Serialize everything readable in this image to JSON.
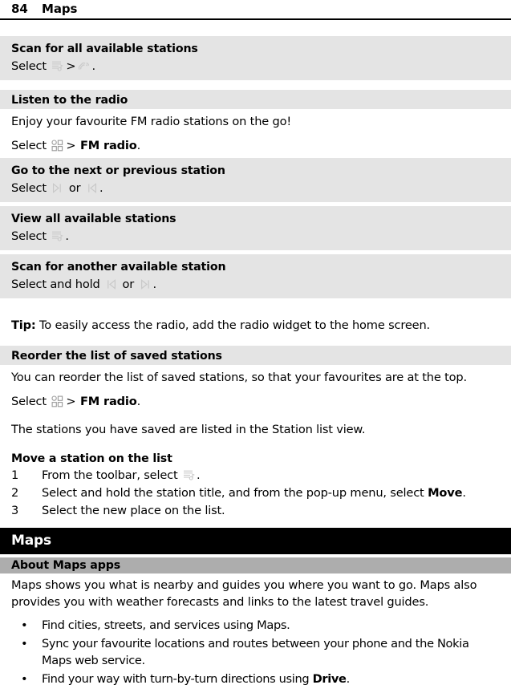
{
  "header": {
    "page_number": "84",
    "chapter": "Maps"
  },
  "sections": {
    "scan_all": {
      "heading": "Scan for all available stations",
      "line_prefix": "Select",
      "icon_1": "station-list-icon",
      "separator": ">",
      "icon_2": "scan-stations-icon",
      "line_suffix": "."
    },
    "listen_radio": {
      "heading": "Listen to the radio",
      "intro": "Enjoy your favourite FM radio stations on the go!",
      "select_prefix": "Select",
      "icon": "app-grid-icon",
      "separator": ">",
      "target": "FM radio",
      "period": "."
    },
    "next_prev": {
      "heading": "Go to the next or previous station",
      "line_prefix": "Select",
      "icon_1": "next-station-icon",
      "conjunction": "or",
      "icon_2": "previous-station-icon",
      "line_suffix": "."
    },
    "view_all": {
      "heading": "View all available stations",
      "line_prefix": "Select",
      "icon_1": "station-list-icon",
      "line_suffix": "."
    },
    "scan_another": {
      "heading": "Scan for another available station",
      "line_prefix": "Select and hold",
      "icon_1": "previous-station-icon",
      "conjunction": "or",
      "icon_2": "next-station-icon",
      "line_suffix": "."
    },
    "tip": {
      "label": "Tip:",
      "text": "To easily access the radio, add the radio widget to the home screen."
    },
    "reorder": {
      "heading": "Reorder the list of saved stations",
      "paragraph_1": "You can reorder the list of saved stations, so that your favourites are at the top.",
      "select_prefix": "Select",
      "icon": "app-grid-icon",
      "separator": ">",
      "target": "FM radio",
      "period": ".",
      "paragraph_2": "The stations you have saved are listed in the Station list view."
    },
    "move_station": {
      "heading": "Move a station on the list",
      "steps": [
        {
          "number": "1",
          "text_before": "From the toolbar, select",
          "icon": "station-list-icon",
          "text_after": ".",
          "bold_term": "",
          "text_tail": ""
        },
        {
          "number": "2",
          "text_before": "Select and hold the station title, and from the pop-up menu, select",
          "icon": "",
          "bold_term": "Move",
          "text_tail": "."
        },
        {
          "number": "3",
          "text_before": "Select the new place on the list.",
          "icon": "",
          "bold_term": "",
          "text_tail": ""
        }
      ]
    }
  },
  "chapter": {
    "title": "Maps",
    "section_title": "About Maps apps",
    "intro": "Maps shows you what is nearby and guides you where you want to go. Maps also provides you with weather forecasts and links to the latest travel guides.",
    "bullets": [
      {
        "text_before": "Find cities, streets, and services using Maps.",
        "bold_term": "",
        "text_after": ""
      },
      {
        "text_before": "Sync your favourite locations and routes between your phone and the Nokia Maps web service.",
        "bold_term": "",
        "text_after": ""
      },
      {
        "text_before": "Find your way with turn-by-turn directions using",
        "bold_term": "Drive",
        "text_after": "."
      }
    ],
    "bullet_glyph": "•"
  },
  "colors": {
    "band_gray": "#e4e4e4",
    "banner_gray": "#adadad",
    "chapter_black": "#000000",
    "icon_gray": "#c9c9c9"
  }
}
